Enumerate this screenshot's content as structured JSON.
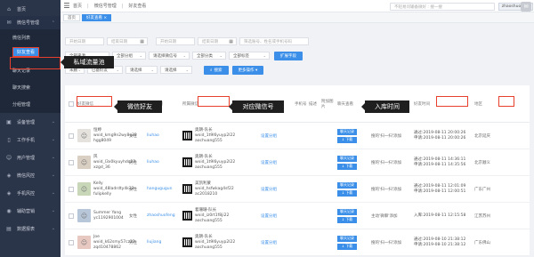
{
  "sidebar": {
    "items": [
      {
        "label": "首页",
        "icon": "home-icon"
      },
      {
        "label": "微信号管理",
        "icon": "wechat-icon"
      },
      {
        "label": "微信列表"
      },
      {
        "label": "好友查看"
      },
      {
        "label": "聊天记录"
      },
      {
        "label": "聊天搜索"
      },
      {
        "label": "分组管理"
      },
      {
        "label": "设备管理",
        "icon": "device-icon"
      },
      {
        "label": "工作手机",
        "icon": "phone-icon"
      },
      {
        "label": "用户管理",
        "icon": "user-icon"
      },
      {
        "label": "微信风控",
        "icon": "shield-icon"
      },
      {
        "label": "手机风控",
        "icon": "shield-icon"
      },
      {
        "label": "辅助营销",
        "icon": "megaphone-icon"
      },
      {
        "label": "数据报表",
        "icon": "chart-icon"
      }
    ]
  },
  "topbar": {
    "breadcrumbs": [
      "首页",
      "微信号管理",
      "好友查看"
    ],
    "search_placeholder": "不轻易问输备微好 : 搜一搜",
    "user": "zhaoshuofeng"
  },
  "tabs": [
    {
      "label": "首页"
    },
    {
      "label": "好友查看 ×"
    }
  ],
  "filters": {
    "row1": [
      "开始日期",
      "结束日期",
      "",
      "开始日期",
      "结束日期",
      "筛选账号、姓名或手机号码"
    ],
    "row2": [
      "全部来源",
      "全部分组",
      "请选择微信号",
      "全部分类",
      "全部标签"
    ],
    "row2_button": "扩展字段",
    "row3": [
      "未删",
      "已备好友",
      "请选择",
      "请选择"
    ],
    "search_button": "搜索",
    "more_button": "更多操作 ▾"
  },
  "table": {
    "headers": [
      "好友微信",
      "性别",
      "分配客服",
      "所属微信",
      "好友备注",
      "所属分组",
      "手机号",
      "描述",
      "附加图片",
      "聊天查看",
      "来源",
      "好友时间",
      "地区"
    ],
    "rows": [
      {
        "name": "恒婷",
        "wxid": "wxid_kmg9n2wy8u22",
        "alias": "hgg8049",
        "gender": "女性",
        "agent": "liuhao",
        "own": [
          "奥朗-队长",
          "wxid_1t9l6yuyp2l22",
          "aochuang555"
        ],
        "group": "设置分组",
        "source": "搜的'扫一扫'添加",
        "time": [
          "通过:2019-08-11 20:00:26",
          "申请:2019-08-11 20:00:26"
        ],
        "region": "北京延庆"
      },
      {
        "name": "风",
        "wxid": "wxid_l3x0kyuyhdq22",
        "alias": "xzgd_36",
        "gender": "男性",
        "agent": "liuhao",
        "own": [
          "奥朗-队长",
          "wxid_1t9l6yuyp2l22",
          "aochuang555"
        ],
        "group": "设置分组",
        "source": "搜的'扫一扫'添加",
        "time": [
          "通过:2019-08-11 14:36:11",
          "申请:2019-08-11 14:35:56"
        ],
        "region": "北京顺义"
      },
      {
        "name": "Kelly",
        "wxid": "wxid_48ladrdty4k22",
        "alias": "fulipkelly",
        "gender": "女性",
        "agent": "hangugugun",
        "own": [
          "美凯利蒙",
          "wxid_hsfwkag4sf22",
          "ac2018210"
        ],
        "group": "设置分组",
        "source": "搜的'扫一扫'添加",
        "time": [
          "通过:2019-08-11 12:01:09",
          "申请:2019-08-11 12:00:51"
        ],
        "region": "广东广州"
      },
      {
        "name": "Summer Yang",
        "wxid": "yc1192901004",
        "alias": "",
        "gender": "女性",
        "agent": "zhaoshuofeng",
        "own": [
          "着珊珊-队长",
          "wxid_iz0rt1f8ji22",
          "aochuang555"
        ],
        "group": "设置分组",
        "source": "主动'微聊'添加",
        "time": [
          "入库:2019-08-11 12:15:58"
        ],
        "region": "江苏苏州"
      },
      {
        "name": "Joe",
        "wxid": "wxid_k62smy57cz22",
        "alias": "zqd10478862",
        "gender": "男性",
        "agent": "liujiang",
        "own": [
          "奥朗-队长",
          "wxid_1t9l6yuyp2l22",
          "aochuang555"
        ],
        "group": "设置分组",
        "source": "搜的'扫一扫'添加",
        "time": [
          "通过:2019-08-10 21:38:12",
          "申请:2019-08-10 21:38:12"
        ],
        "region": "广东佛山"
      }
    ],
    "row_buttons": {
      "chat": "聊天记录",
      "download": "↓ 下载"
    }
  },
  "annotations": {
    "pool": "私域流量池",
    "friend": "微信好友",
    "account": "对应微信号",
    "time": "入库时间"
  }
}
